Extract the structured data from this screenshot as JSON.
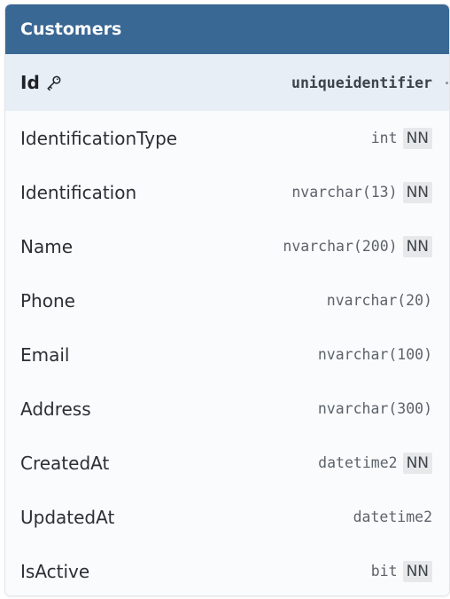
{
  "table": {
    "title": "Customers",
    "columns": [
      {
        "name": "Id",
        "type": "uniqueidentifier",
        "primary_key": true,
        "icon": "key-icon",
        "nn": ""
      },
      {
        "name": "IdentificationType",
        "type": "int",
        "primary_key": false,
        "nn": "NN"
      },
      {
        "name": "Identification",
        "type": "nvarchar(13)",
        "primary_key": false,
        "nn": "NN"
      },
      {
        "name": "Name",
        "type": "nvarchar(200)",
        "primary_key": false,
        "nn": "NN"
      },
      {
        "name": "Phone",
        "type": "nvarchar(20)",
        "primary_key": false,
        "nn": ""
      },
      {
        "name": "Email",
        "type": "nvarchar(100)",
        "primary_key": false,
        "nn": ""
      },
      {
        "name": "Address",
        "type": "nvarchar(300)",
        "primary_key": false,
        "nn": ""
      },
      {
        "name": "CreatedAt",
        "type": "datetime2",
        "primary_key": false,
        "nn": "NN"
      },
      {
        "name": "UpdatedAt",
        "type": "datetime2",
        "primary_key": false,
        "nn": ""
      },
      {
        "name": "IsActive",
        "type": "bit",
        "primary_key": false,
        "nn": "NN"
      }
    ]
  },
  "colors": {
    "header_bg": "#3a6894",
    "header_text": "#ffffff",
    "pk_row_bg": "#e8eef5",
    "row_bg": "#fafbfc",
    "nn_badge_bg": "#e6e8ea"
  }
}
